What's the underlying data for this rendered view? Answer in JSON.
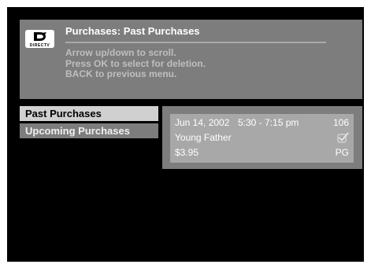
{
  "header": {
    "logo_text": "DIRECTV",
    "title": "Purchases: Past Purchases",
    "instructions": [
      "Arrow up/down to scroll.",
      "Press OK to select for deletion.",
      "BACK to previous menu."
    ]
  },
  "menu": {
    "items": [
      {
        "label": "Past Purchases",
        "selected": true
      },
      {
        "label": "Upcoming Purchases",
        "selected": false
      }
    ]
  },
  "purchase": {
    "date": "Jun 14, 2002",
    "time": "5:30 - 7:15 pm",
    "channel": "106",
    "title": "Young Father",
    "price": "$3.95",
    "rating": "PG",
    "checkbox_icon": "checkbox-check-icon",
    "checked": true
  },
  "colors": {
    "screen_background": "#000000",
    "panel_gray": "#7d7d7d",
    "card_gray": "#a8a8a8",
    "selected_menu": "#d0d0d0"
  }
}
